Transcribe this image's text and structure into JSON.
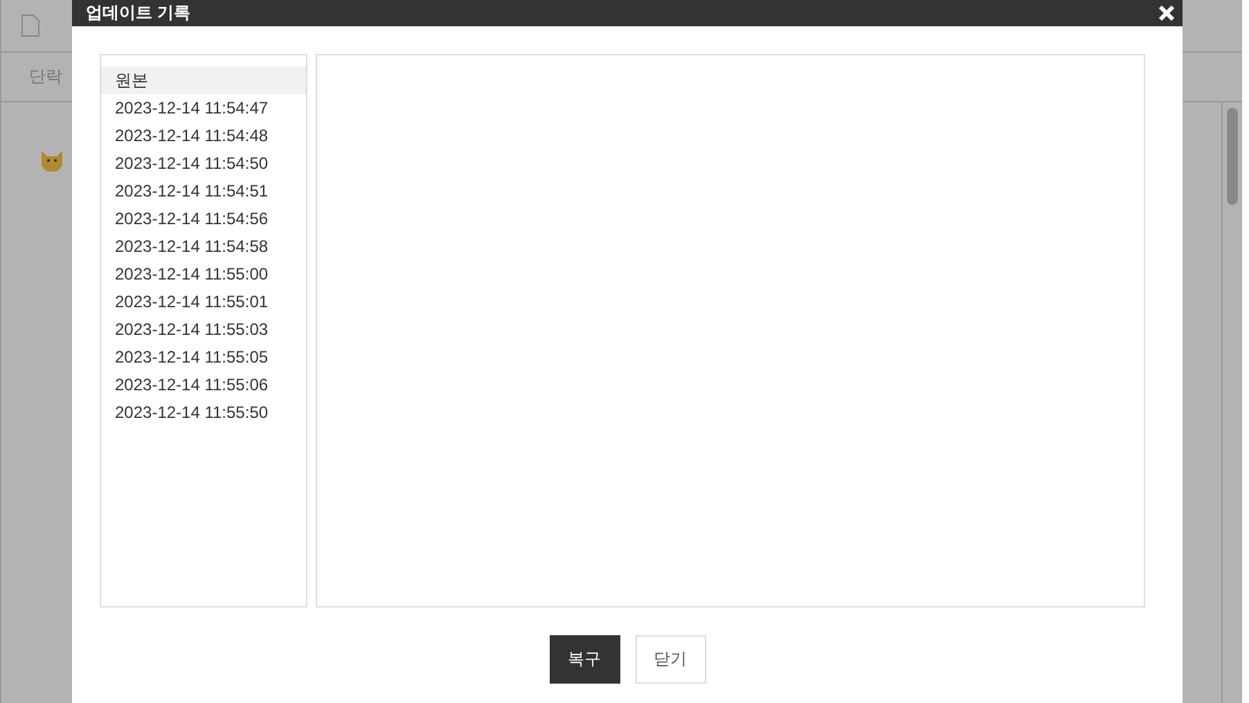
{
  "background_editor": {
    "paragraph_label": "단락"
  },
  "dialog": {
    "title": "업데이트 기록",
    "versions": [
      {
        "label": "원본",
        "selected": true
      },
      {
        "label": "2023-12-14 11:54:47",
        "selected": false
      },
      {
        "label": "2023-12-14 11:54:48",
        "selected": false
      },
      {
        "label": "2023-12-14 11:54:50",
        "selected": false
      },
      {
        "label": "2023-12-14 11:54:51",
        "selected": false
      },
      {
        "label": "2023-12-14 11:54:56",
        "selected": false
      },
      {
        "label": "2023-12-14 11:54:58",
        "selected": false
      },
      {
        "label": "2023-12-14 11:55:00",
        "selected": false
      },
      {
        "label": "2023-12-14 11:55:01",
        "selected": false
      },
      {
        "label": "2023-12-14 11:55:03",
        "selected": false
      },
      {
        "label": "2023-12-14 11:55:05",
        "selected": false
      },
      {
        "label": "2023-12-14 11:55:06",
        "selected": false
      },
      {
        "label": "2023-12-14 11:55:50",
        "selected": false
      }
    ],
    "buttons": [
      {
        "label": "복구",
        "kind": "primary"
      },
      {
        "label": "닫기",
        "kind": "secondary"
      }
    ]
  }
}
